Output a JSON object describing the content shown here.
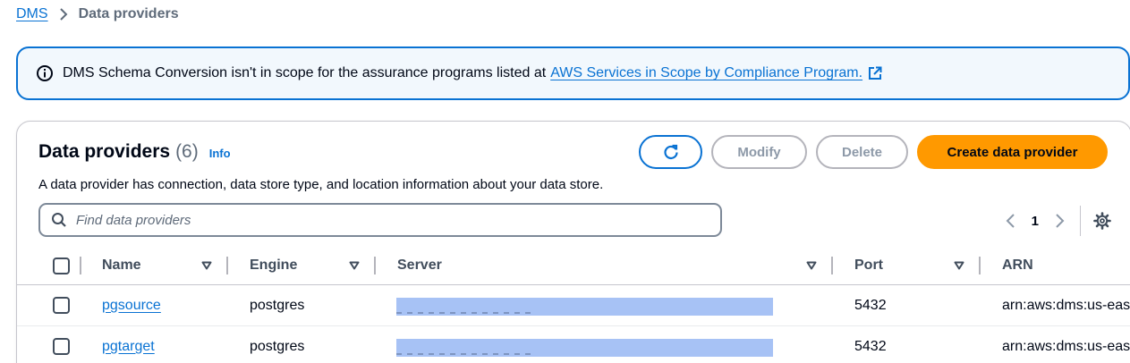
{
  "breadcrumb": {
    "root": "DMS",
    "current": "Data providers"
  },
  "banner": {
    "text": "DMS Schema Conversion isn't in scope for the assurance programs listed at",
    "link": "AWS Services in Scope by Compliance Program."
  },
  "panel": {
    "title": "Data providers",
    "count": "(6)",
    "info": "Info",
    "description": "A data provider has connection, data store type, and location information about your data store."
  },
  "actions": {
    "modify": "Modify",
    "delete": "Delete",
    "create": "Create data provider"
  },
  "search": {
    "placeholder": "Find data providers"
  },
  "pagination": {
    "page": "1"
  },
  "table": {
    "columns": [
      "Name",
      "Engine",
      "Server",
      "Port",
      "ARN"
    ],
    "rows": [
      {
        "name": "pgsource",
        "engine": "postgres",
        "port": "5432",
        "arn": "arn:aws:dms:us-eas"
      },
      {
        "name": "pgtarget",
        "engine": "postgres",
        "port": "5432",
        "arn": "arn:aws:dms:us-eas"
      }
    ]
  },
  "colors": {
    "link": "#0972d3",
    "primary": "#ff9900",
    "banner_bg": "#f2f8fd",
    "redaction": "#a7c2f5"
  },
  "icons": [
    "chevron-right-icon",
    "info-icon",
    "external-link-icon",
    "refresh-icon",
    "search-icon",
    "chevron-left-icon",
    "settings-icon",
    "sort-down-icon"
  ]
}
